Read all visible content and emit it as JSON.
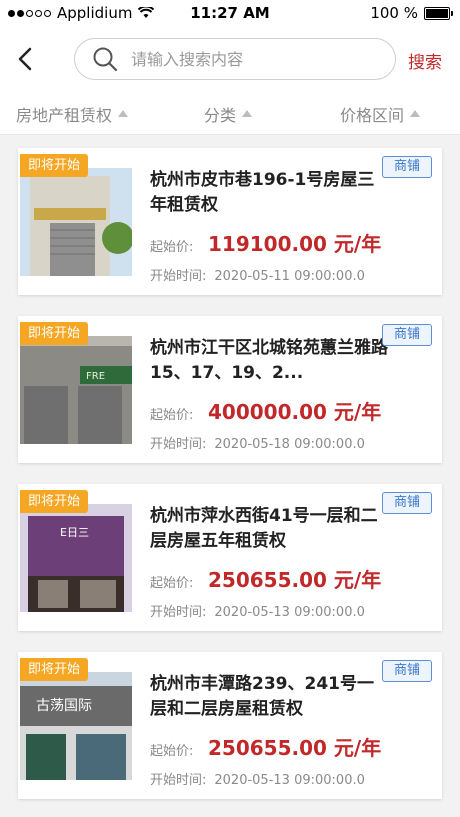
{
  "status_bar": {
    "carrier": "Applidium",
    "time": "11:27 AM",
    "battery": "100 %"
  },
  "header": {
    "search_placeholder": "请输入搜索内容",
    "search_button": "搜索"
  },
  "filters": [
    {
      "label": "房地产租赁权"
    },
    {
      "label": "分类"
    },
    {
      "label": "价格区间"
    }
  ],
  "listings": [
    {
      "badge": "即将开始",
      "title": "杭州市皮市巷196-1号房屋三年租赁权",
      "type": "商铺",
      "price_label": "起始价:",
      "price": "119100.00 元/年",
      "start_label": "开始时间:",
      "start_time": "2020-05-11 09:00:00.0",
      "image_colors": {
        "sky": "#cfe0ef",
        "wall": "#d9d4c8",
        "door": "#8f8f8f",
        "tree": "#5f8f3a"
      }
    },
    {
      "badge": "即将开始",
      "title": "杭州市江干区北城铭苑蕙兰雅路15、17、19、2...",
      "type": "商铺",
      "price_label": "起始价:",
      "price": "400000.00 元/年",
      "start_label": "开始时间:",
      "start_time": "2020-05-18 09:00:00.0",
      "image_colors": {
        "sky": "#b9b6ae",
        "wall": "#8c8a84",
        "door": "#6f6f6f",
        "tree": "#2f6b3a"
      }
    },
    {
      "badge": "即将开始",
      "title": "杭州市萍水西街41号一层和二层房屋五年租赁权",
      "type": "商铺",
      "price_label": "起始价:",
      "price": "250655.00 元/年",
      "start_label": "开始时间:",
      "start_time": "2020-05-13 09:00:00.0",
      "image_colors": {
        "sky": "#d7d1e1",
        "wall": "#6d3f78",
        "door": "#3a2e2a",
        "tree": "#7a6f8a"
      }
    },
    {
      "badge": "即将开始",
      "title": "杭州市丰潭路239、241号一层和二层房屋租赁权",
      "type": "商铺",
      "price_label": "起始价:",
      "price": "250655.00 元/年",
      "start_label": "开始时间:",
      "start_time": "2020-05-13 09:00:00.0",
      "image_colors": {
        "sky": "#c9d6df",
        "wall": "#6a6a6a",
        "door": "#2e5a4a",
        "tree": "#3f7a55"
      }
    }
  ]
}
